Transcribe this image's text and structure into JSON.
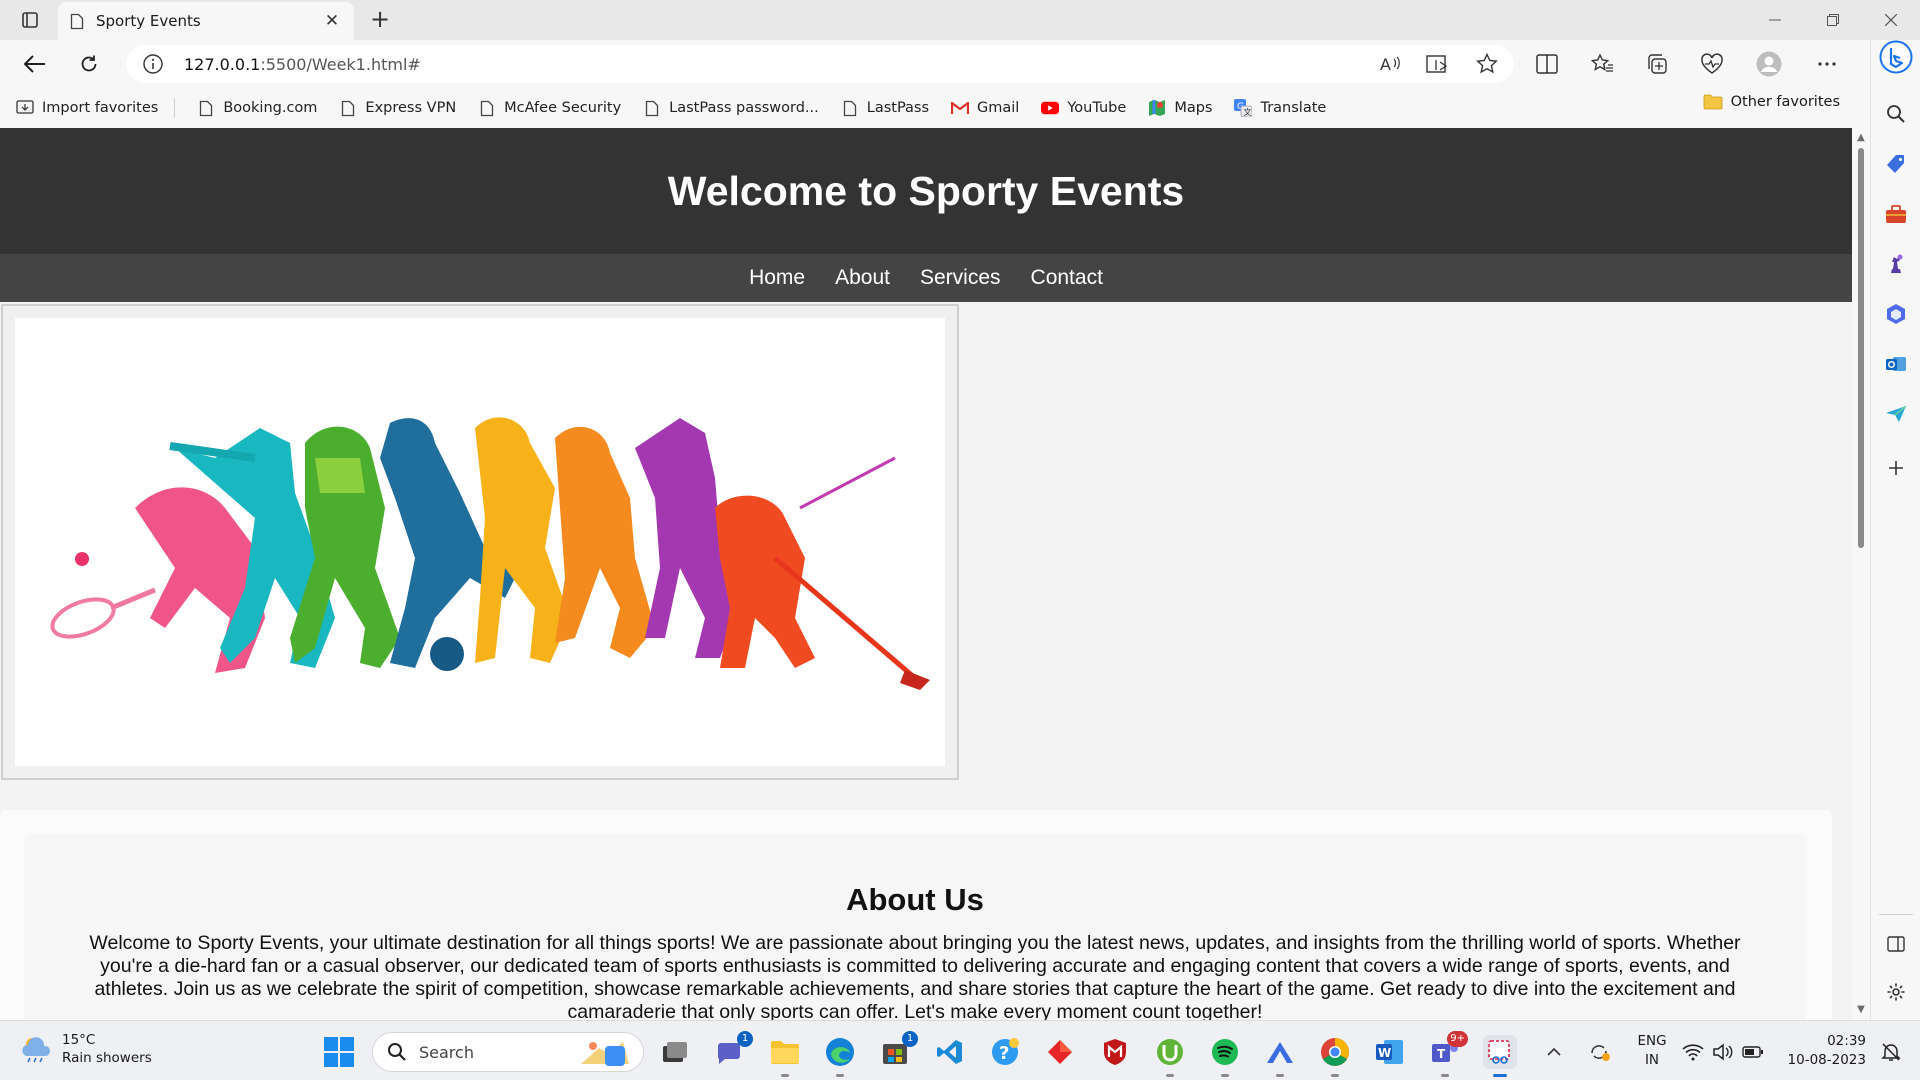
{
  "browser": {
    "tab": {
      "title": "Sporty Events"
    },
    "url_host": "127.0.0.1",
    "url_path": ":5500/Week1.html#",
    "bookmarks": [
      {
        "label": "Import favorites",
        "icon": "import-icon"
      },
      {
        "label": "Booking.com",
        "icon": "page-icon"
      },
      {
        "label": "Express VPN",
        "icon": "page-icon"
      },
      {
        "label": "McAfee Security",
        "icon": "page-icon"
      },
      {
        "label": "LastPass password...",
        "icon": "page-icon"
      },
      {
        "label": "LastPass",
        "icon": "page-icon"
      },
      {
        "label": "Gmail",
        "icon": "gmail-icon"
      },
      {
        "label": "YouTube",
        "icon": "youtube-icon"
      },
      {
        "label": "Maps",
        "icon": "maps-icon"
      },
      {
        "label": "Translate",
        "icon": "translate-icon"
      }
    ],
    "other_favorites": "Other favorites"
  },
  "site": {
    "header_title": "Welcome to Sporty Events",
    "nav": [
      "Home",
      "About",
      "Services",
      "Contact"
    ],
    "hero_image": "sports-athletes-silhouette-illustration",
    "about": {
      "heading": "About Us",
      "body": "Welcome to Sporty Events, your ultimate destination for all things sports! We are passionate about bringing you the latest news, updates, and insights from the thrilling world of sports. Whether you're a die-hard fan or a casual observer, our dedicated team of sports enthusiasts is committed to delivering accurate and engaging content that covers a wide range of sports, events, and athletes. Join us as we celebrate the spirit of competition, showcase remarkable achievements, and share stories that capture the heart of the game. Get ready to dive into the excitement and camaraderie that only sports can offer. Let's make every moment count together!"
    }
  },
  "taskbar": {
    "weather_temp": "15°C",
    "weather_desc": "Rain showers",
    "search_label": "Search",
    "lang_top": "ENG",
    "lang_bottom": "IN",
    "time": "02:39",
    "date": "10-08-2023",
    "badges": {
      "chat": "1",
      "store": "1",
      "teams": "9+"
    }
  },
  "colors": {
    "header_bg": "#333333",
    "nav_bg": "#444444",
    "accent": "#0b63c4"
  }
}
